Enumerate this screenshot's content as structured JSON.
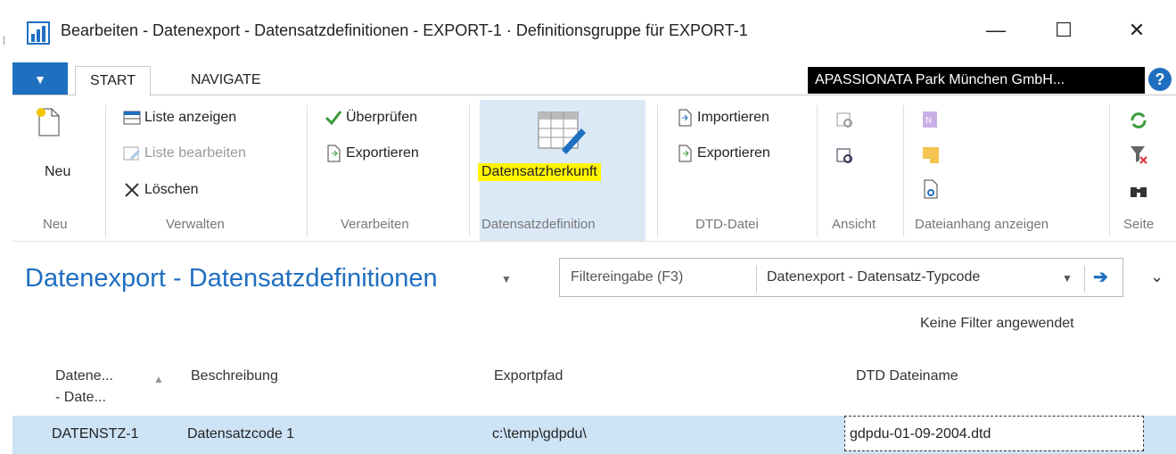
{
  "window": {
    "title": "Bearbeiten - Datenexport - Datensatzdefinitionen - EXPORT-1 · Definitionsgruppe für EXPORT-1"
  },
  "ribbon": {
    "tabs": [
      "START",
      "NAVIGATE"
    ],
    "company": "APASSIONATA Park München GmbH...",
    "help": "?",
    "groups": {
      "neu": {
        "label": "Neu",
        "new_button": "Neu"
      },
      "verwalten": {
        "label": "Verwalten",
        "show_list": "Liste anzeigen",
        "edit_list": "Liste bearbeiten",
        "delete": "Löschen"
      },
      "verarbeiten": {
        "label": "Verarbeiten",
        "check": "Überprüfen",
        "export": "Exportieren"
      },
      "datensatzdefinition": {
        "label": "Datensatzdefinition",
        "origin": "Datensatzherkunft"
      },
      "dtd": {
        "label": "DTD-Datei",
        "import": "Importieren",
        "export": "Exportieren"
      },
      "ansicht": {
        "label": "Ansicht"
      },
      "dateianhang": {
        "label": "Dateianhang anzeigen"
      },
      "seite": {
        "label": "Seite"
      }
    }
  },
  "page": {
    "title": "Datenexport - Datensatzdefinitionen",
    "filter_placeholder": "Filtereingabe (F3)",
    "filter_field": "Datenexport - Datensatz-Typcode",
    "no_filter": "Keine Filter angewendet"
  },
  "table": {
    "columns": [
      "Datene... - Date...",
      "Beschreibung",
      "Exportpfad",
      "DTD Dateiname"
    ],
    "col0_line1": "Datene...",
    "col0_line2": "- Date...",
    "rows": [
      {
        "code": "DATENSTZ-1",
        "description": "Datensatzcode 1",
        "path": "c:\\temp\\gdpdu\\",
        "dtd": "gdpdu-01-09-2004.dtd"
      }
    ]
  },
  "colors": {
    "accent": "#1f6fc1",
    "highlight": "#fff500",
    "selected_row": "#cde3f6"
  }
}
